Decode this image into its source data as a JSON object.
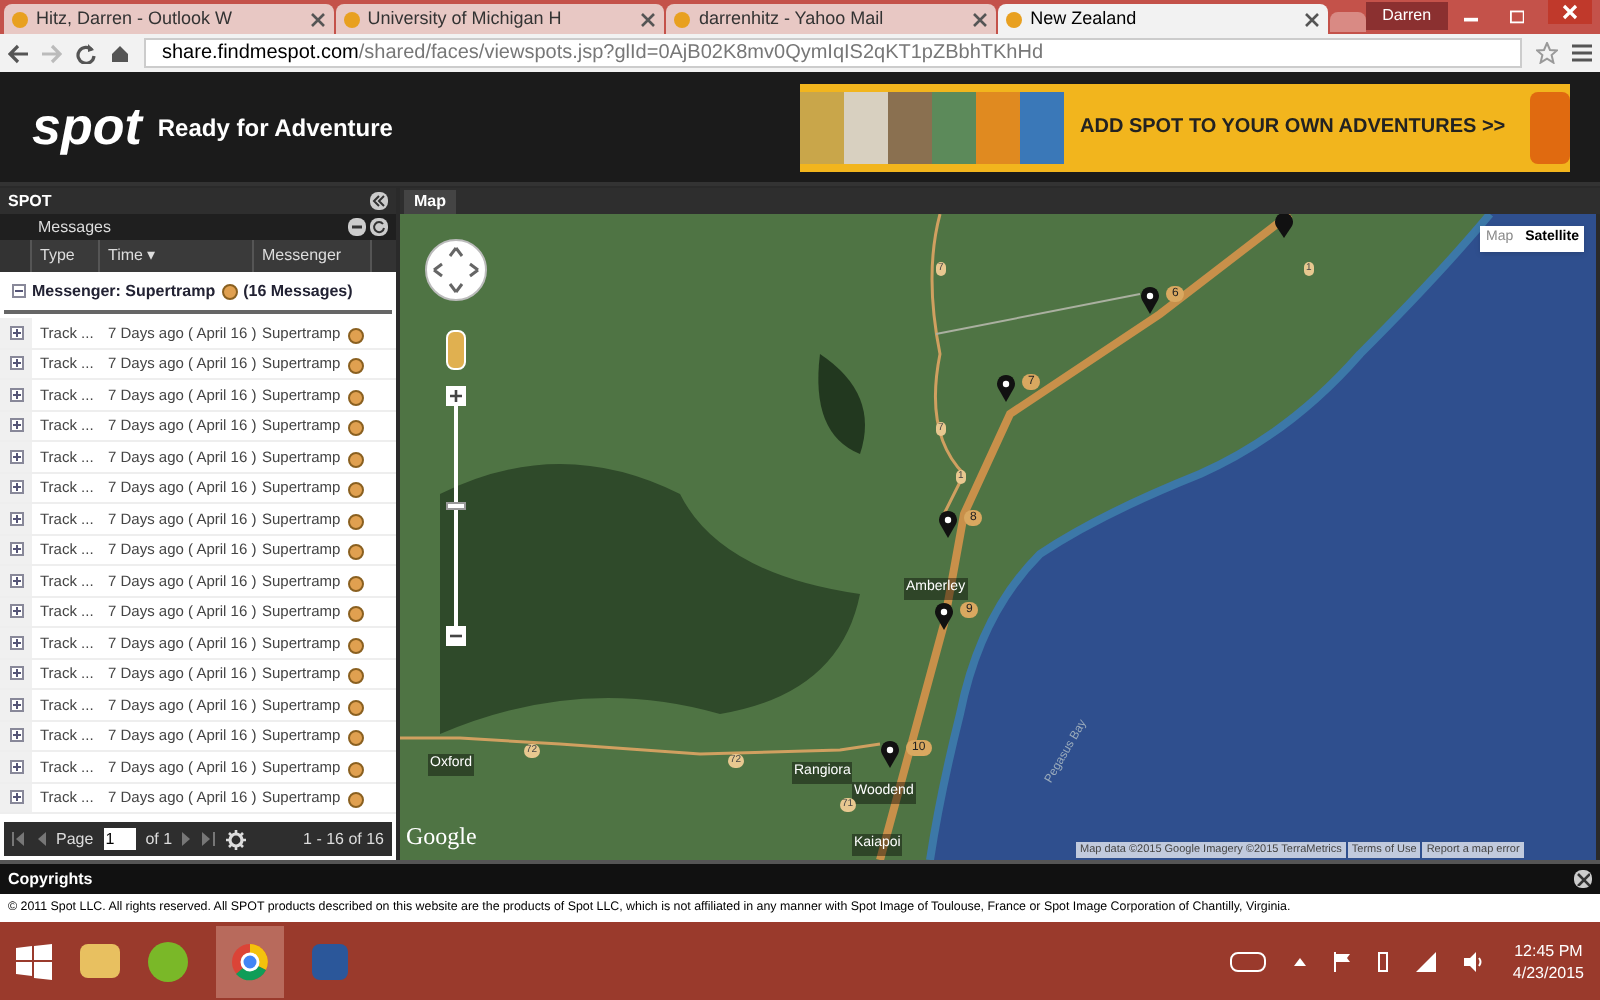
{
  "browser": {
    "tabs": [
      {
        "label": "Hitz, Darren - Outlook W",
        "selected": false
      },
      {
        "label": "University of Michigan H",
        "selected": false
      },
      {
        "label": "darrenhitz - Yahoo Mail",
        "selected": false
      },
      {
        "label": "New Zealand",
        "selected": true
      }
    ],
    "user": "Darren",
    "url": {
      "host": "share.findmespot.com",
      "path": "/shared/faces/viewspots.jsp?glId=0AjB02K8mv0QymIqIS2qKT1pZBbhTKhHd"
    }
  },
  "header": {
    "logo": "spot",
    "tagline": "Ready for Adventure",
    "banner": "ADD SPOT TO YOUR OWN ADVENTURES >>"
  },
  "panel": {
    "title": "SPOT",
    "subtitle": "Messages",
    "columns": [
      "Type",
      "Time ▾",
      "Messenger"
    ],
    "group": {
      "label": "Messenger: Supertramp",
      "count": "(16 Messages)",
      "expanded": true
    },
    "rows": [
      {
        "type": "Track ...",
        "time": "7 Days ago ( April 16 )",
        "messenger": "Supertramp"
      },
      {
        "type": "Track ...",
        "time": "7 Days ago ( April 16 )",
        "messenger": "Supertramp"
      },
      {
        "type": "Track ...",
        "time": "7 Days ago ( April 16 )",
        "messenger": "Supertramp"
      },
      {
        "type": "Track ...",
        "time": "7 Days ago ( April 16 )",
        "messenger": "Supertramp"
      },
      {
        "type": "Track ...",
        "time": "7 Days ago ( April 16 )",
        "messenger": "Supertramp"
      },
      {
        "type": "Track ...",
        "time": "7 Days ago ( April 16 )",
        "messenger": "Supertramp"
      },
      {
        "type": "Track ...",
        "time": "7 Days ago ( April 16 )",
        "messenger": "Supertramp"
      },
      {
        "type": "Track ...",
        "time": "7 Days ago ( April 16 )",
        "messenger": "Supertramp"
      },
      {
        "type": "Track ...",
        "time": "7 Days ago ( April 16 )",
        "messenger": "Supertramp"
      },
      {
        "type": "Track ...",
        "time": "7 Days ago ( April 16 )",
        "messenger": "Supertramp"
      },
      {
        "type": "Track ...",
        "time": "7 Days ago ( April 16 )",
        "messenger": "Supertramp"
      },
      {
        "type": "Track ...",
        "time": "7 Days ago ( April 16 )",
        "messenger": "Supertramp"
      },
      {
        "type": "Track ...",
        "time": "7 Days ago ( April 16 )",
        "messenger": "Supertramp"
      },
      {
        "type": "Track ...",
        "time": "7 Days ago ( April 16 )",
        "messenger": "Supertramp"
      },
      {
        "type": "Track ...",
        "time": "7 Days ago ( April 16 )",
        "messenger": "Supertramp"
      },
      {
        "type": "Track ...",
        "time": "7 Days ago ( April 16 )",
        "messenger": "Supertramp"
      }
    ],
    "pager": {
      "page_label": "Page",
      "page": "1",
      "of": "of 1",
      "summary": "1 - 16 of 16"
    }
  },
  "map": {
    "tab": "Map",
    "types": [
      {
        "label": "Map",
        "selected": false
      },
      {
        "label": "Satellite",
        "selected": true
      }
    ],
    "zoom": {
      "level": 0.55
    },
    "markers": [
      "6",
      "7",
      "8",
      "9",
      "10"
    ],
    "places": [
      "Amberley",
      "Oxford",
      "Rangiora",
      "Woodend",
      "Kaiapoi",
      "Pegasus Bay"
    ],
    "shields": [
      "72",
      "72",
      "71",
      "1",
      "1",
      "7",
      "7"
    ],
    "logo": "Google",
    "attribution": [
      "Map data ©2015 Google Imagery ©2015 TerraMetrics",
      "Terms of Use",
      "Report a map error"
    ]
  },
  "footer": {
    "title": "Copyrights",
    "text": "© 2011 Spot LLC. All rights reserved. All SPOT products described on this website are the products of Spot LLC, which is not affiliated in any manner with Spot Image of Toulouse, France or Spot Image Corporation of Chantilly, Virginia."
  },
  "taskbar": {
    "time": "12:45 PM",
    "date": "4/23/2015"
  }
}
